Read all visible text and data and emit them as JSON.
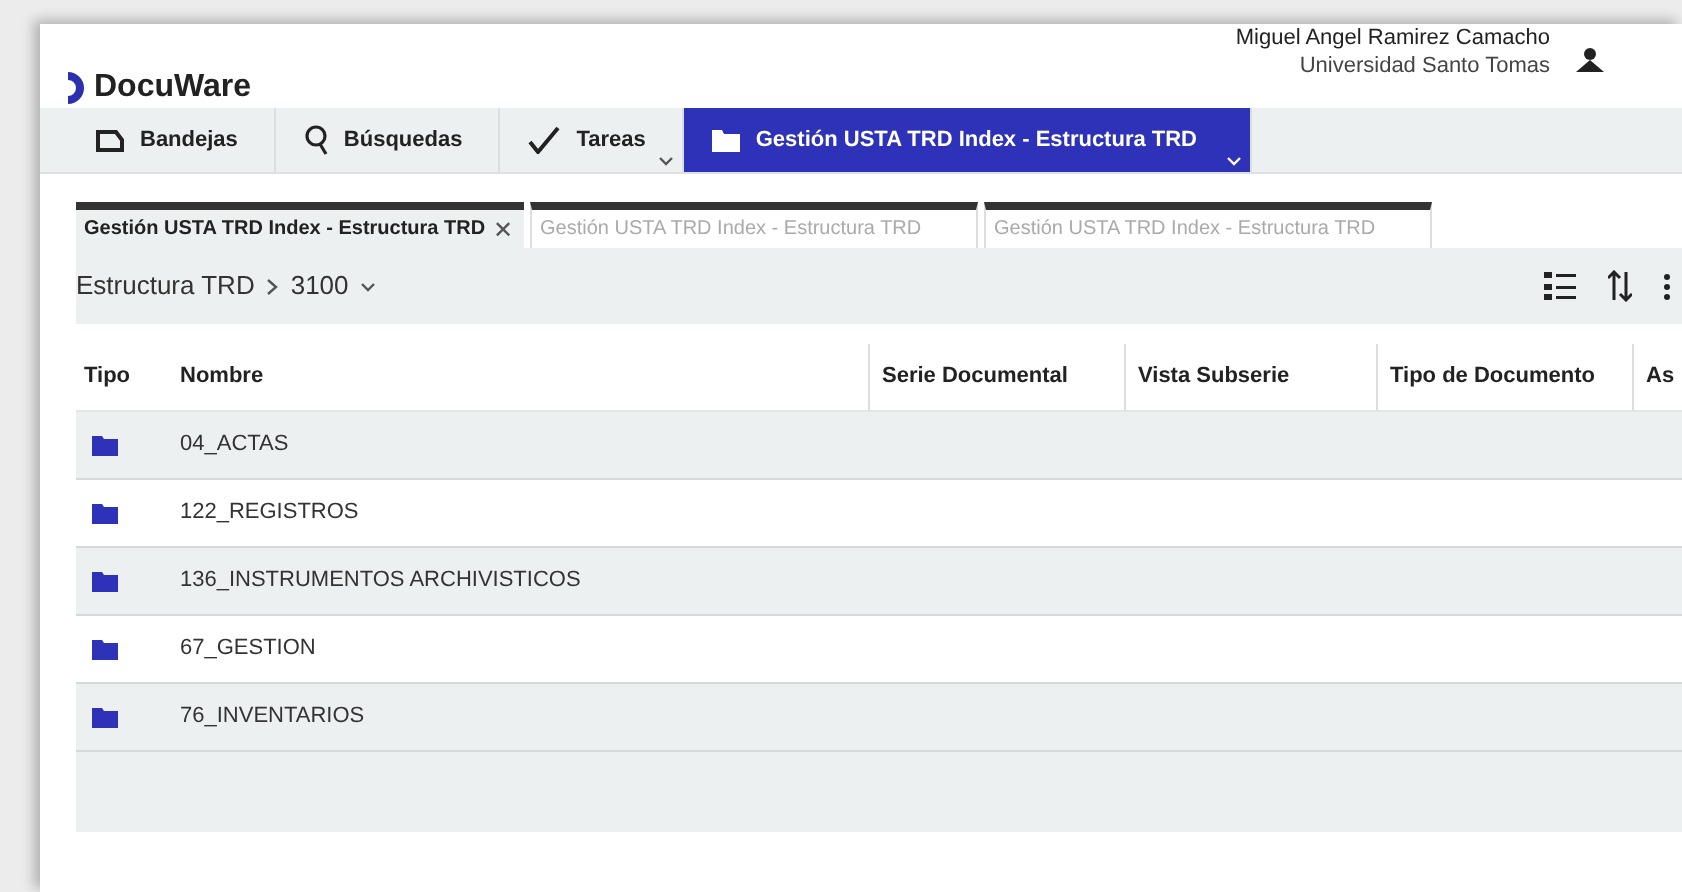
{
  "header": {
    "logo": "DocuWare",
    "user_name": "Miguel Angel Ramirez Camacho",
    "organization": "Universidad Santo Tomas"
  },
  "nav": [
    {
      "label": "Bandejas",
      "selected": false,
      "dropdown": false
    },
    {
      "label": "Búsquedas",
      "selected": false,
      "dropdown": false
    },
    {
      "label": "Tareas",
      "selected": false,
      "dropdown": true
    },
    {
      "label": "Gestión USTA TRD Index - Estructura TRD",
      "selected": true,
      "dropdown": true
    }
  ],
  "tabs": [
    {
      "label": "Gestión USTA TRD Index - Estructura TRD",
      "selected": true,
      "close": "✕"
    },
    {
      "label": "Gestión USTA TRD Index - Estructura TRD",
      "selected": false
    },
    {
      "label": "Gestión USTA TRD Index - Estructura TRD",
      "selected": false
    }
  ],
  "breadcrumb": [
    "Estructura TRD",
    "3100"
  ],
  "table": {
    "columns": [
      "Tipo",
      "Nombre",
      "Serie Documental",
      "Vista Subserie",
      "Tipo de Documento",
      "As"
    ],
    "rows": [
      {
        "nombre": "04_ACTAS"
      },
      {
        "nombre": "122_REGISTROS"
      },
      {
        "nombre": "136_INSTRUMENTOS ARCHIVISTICOS"
      },
      {
        "nombre": "67_GESTION"
      },
      {
        "nombre": "76_INVENTARIOS"
      }
    ]
  }
}
